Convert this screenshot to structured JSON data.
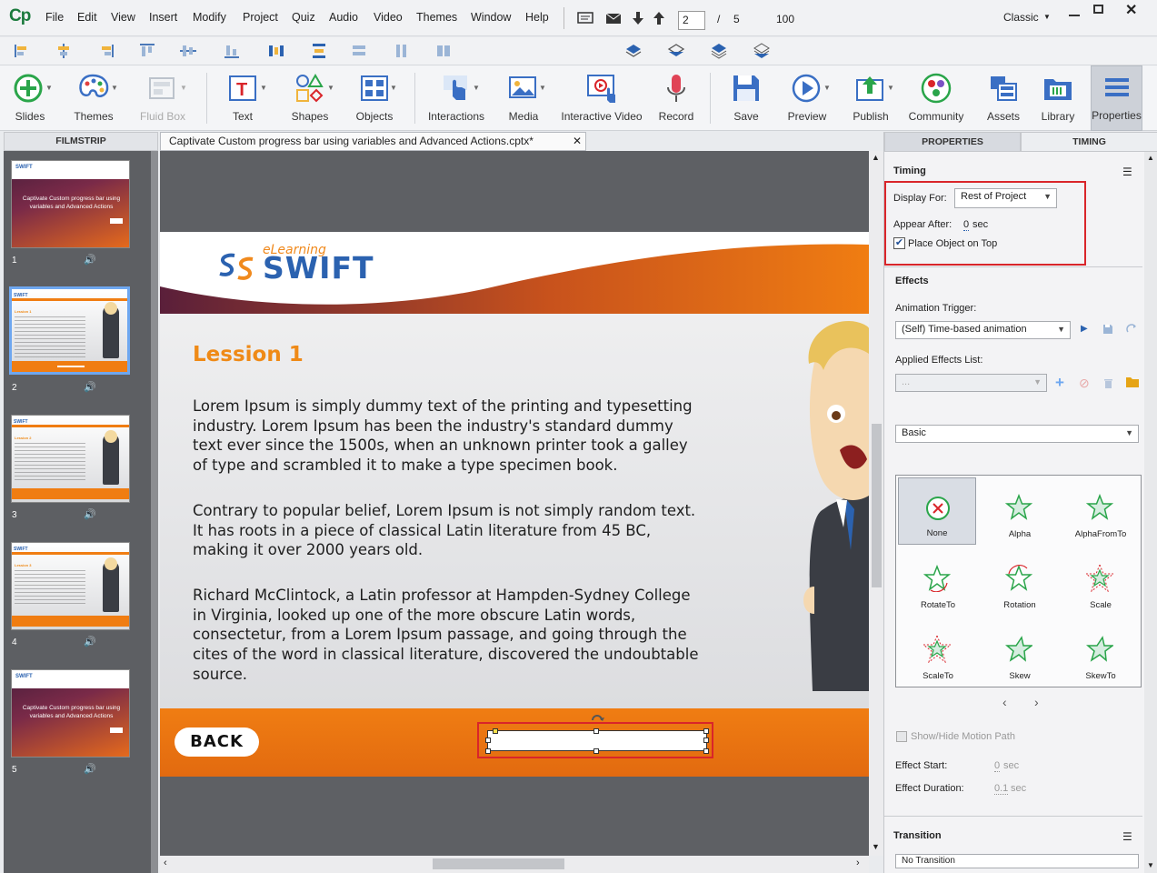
{
  "app": {
    "logo": "Cp",
    "workspace": "Classic"
  },
  "menu": [
    "File",
    "Edit",
    "View",
    "Insert",
    "Modify",
    "Project",
    "Quiz",
    "Audio",
    "Video",
    "Themes",
    "Window",
    "Help"
  ],
  "nav": {
    "current_slide": "2",
    "separator": "/",
    "total_slides": "5",
    "zoom": "100"
  },
  "toolbar": {
    "slides": "Slides",
    "themes": "Themes",
    "fluid_box": "Fluid Box",
    "text": "Text",
    "shapes": "Shapes",
    "objects": "Objects",
    "interactions": "Interactions",
    "media": "Media",
    "interactive_video": "Interactive Video",
    "record": "Record",
    "save": "Save",
    "preview": "Preview",
    "publish": "Publish",
    "community": "Community",
    "assets": "Assets",
    "library": "Library",
    "properties": "Properties"
  },
  "filmstrip": {
    "header": "FILMSTRIP",
    "slides": [
      {
        "num": "1",
        "title": "Captivate Custom progress bar using variables and Advanced Actions"
      },
      {
        "num": "2",
        "title": "Lession 1"
      },
      {
        "num": "3",
        "title": "Lession 2"
      },
      {
        "num": "4",
        "title": "Lession 3"
      },
      {
        "num": "5",
        "title": "Captivate Custom progress bar using variables and Advanced Actions"
      }
    ]
  },
  "document": {
    "tab_title": "Captivate Custom progress bar  using variables and Advanced Actions.cptx*"
  },
  "slide": {
    "brand_small": "eLearning",
    "brand": "SWIFT",
    "heading": "Lession 1",
    "paragraphs": [
      "Lorem Ipsum is simply dummy text of the printing and typesetting industry. Lorem Ipsum has been the industry's standard dummy text ever since the 1500s, when an unknown printer took a galley of type and scrambled it to make a type specimen book.",
      "Contrary to popular belief, Lorem Ipsum is not simply random text. It has roots in a piece of classical Latin literature from 45 BC, making it over 2000 years old.",
      "Richard McClintock, a Latin professor at Hampden-Sydney College in Virginia, looked up one of the more obscure Latin words, consectetur, from a Lorem Ipsum passage, and going through the cites of the word in classical literature, discovered the undoubtable source."
    ],
    "back_button": "BACK"
  },
  "properties": {
    "tab_properties": "PROPERTIES",
    "tab_timing": "TIMING",
    "timing_title": "Timing",
    "display_for_label": "Display For:",
    "display_for_value": "Rest of Project",
    "appear_after_label": "Appear After:",
    "appear_after_value": "0",
    "appear_after_unit": "sec",
    "place_on_top": "Place Object on Top",
    "effects_title": "Effects",
    "animation_trigger_label": "Animation Trigger:",
    "animation_trigger_value": "(Self) Time-based animation",
    "applied_effects_label": "Applied Effects List:",
    "applied_effects_value": "...",
    "category_value": "Basic",
    "effects": [
      "None",
      "Alpha",
      "AlphaFromTo",
      "RotateTo",
      "Rotation",
      "Scale",
      "ScaleTo",
      "Skew",
      "SkewTo"
    ],
    "show_motion_path": "Show/Hide Motion Path",
    "effect_start_label": "Effect Start:",
    "effect_start_value": "0",
    "effect_start_unit": "sec",
    "effect_duration_label": "Effect Duration:",
    "effect_duration_value": "0.1",
    "effect_duration_unit": "sec",
    "transition_title": "Transition",
    "transition_value": "No Transition"
  },
  "colors": {
    "orange": "#f07d12",
    "highlight_red": "#d9252a",
    "heading_orange": "#ef8a17",
    "selection_blue": "#6ea7f0"
  }
}
